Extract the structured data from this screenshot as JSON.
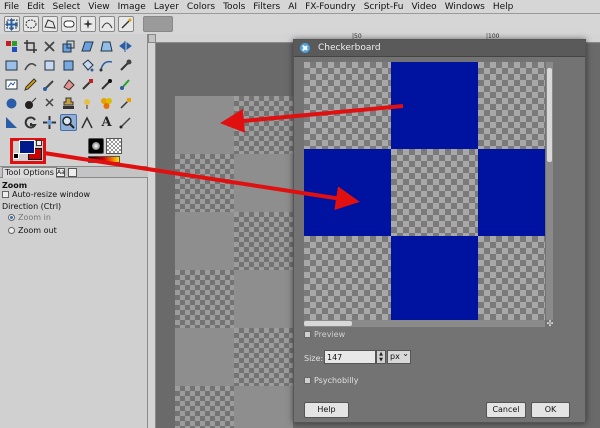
{
  "menubar": {
    "items": [
      "File",
      "Edit",
      "Select",
      "View",
      "Image",
      "Layer",
      "Colors",
      "Tools",
      "Filters",
      "AI",
      "FX-Foundry",
      "Script-Fu",
      "Video",
      "Windows",
      "Help"
    ]
  },
  "colors": {
    "foreground": "#001a8c",
    "background": "#c80000",
    "checker_blue": "#0012a0",
    "annotation": "#e01010"
  },
  "toolbox": {
    "selected_tool": "zoom-tool",
    "text_tool_glyph": "A",
    "tab": {
      "label": "Tool Options",
      "secondary_icon_glyph": "Aa"
    },
    "options": {
      "title": "Zoom",
      "auto_resize": "Auto-resize window",
      "direction_label": "Direction  (Ctrl)",
      "zoom_in": "Zoom in",
      "zoom_out": "Zoom out"
    }
  },
  "rulers": {
    "top_ticks": [
      "|50",
      "|100"
    ]
  },
  "dialog": {
    "title": "Checkerboard",
    "preview_label": "Preview",
    "size_label": "Size:",
    "size_value": "147",
    "unit": "px",
    "psychobilly_label": "Psychobilly",
    "help_label": "Help",
    "cancel_label": "Cancel",
    "ok_label": "OK"
  }
}
